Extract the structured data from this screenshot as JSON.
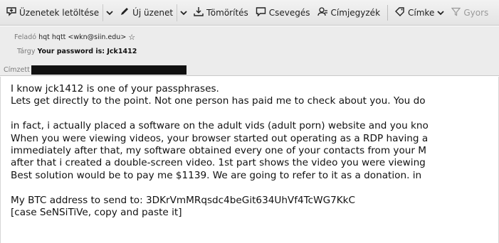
{
  "toolbar": {
    "get_messages": "Üzenetek letöltése",
    "new_message": "Új üzenet",
    "compress": "Tömörítés",
    "chat": "Csevegés",
    "address_book": "Címjegyzék",
    "tag": "Címke",
    "quick_filter": "Gyors"
  },
  "header": {
    "from_label": "Feladó",
    "from_value": "hqt hqtt <wkn@siin.edu>",
    "subject_label": "Tárgy",
    "subject_value": "Your password is: Jck1412",
    "to_label": "Címzett"
  },
  "body": {
    "lines": [
      "I know jck1412 is one of your passphrases.",
      "Lets get directly to the point. Not one person has paid me to check about you. You do",
      "",
      "in fact, i actually placed a software on the adult vids (adult porn) website and you kno",
      "When you were viewing videos, your browser started out operating as a RDP having a",
      "immediately after that, my software obtained every one of your contacts from your M",
      "after that i created a double-screen video. 1st part shows the video you were viewing",
      "Best solution would be to pay me $1139. We are going to refer to it as a donation. in",
      "",
      "My BTC address to send to: 3DKrVmMRqsdc4beGit634UhVf4TcWG7KkC",
      "[case SeNSiTiVe, copy and paste it]"
    ]
  }
}
